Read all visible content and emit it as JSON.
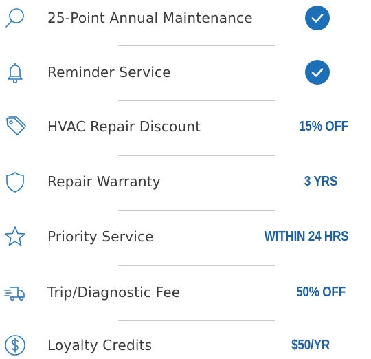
{
  "benefits": [
    {
      "label": "25-Point Annual Maintenance",
      "icon": "search-icon",
      "value": null,
      "included": true
    },
    {
      "label": "Reminder Service",
      "icon": "bell-icon",
      "value": null,
      "included": true
    },
    {
      "label": "HVAC Repair Discount",
      "icon": "tag-icon",
      "value": "15% OFF",
      "included": false
    },
    {
      "label": "Repair Warranty",
      "icon": "shield-icon",
      "value": "3 YRS",
      "included": false
    },
    {
      "label": "Priority Service",
      "icon": "star-icon",
      "value": "WITHIN 24 HRS",
      "included": false
    },
    {
      "label": "Trip/Diagnostic Fee",
      "icon": "delivery-truck-icon",
      "value": "50% OFF",
      "included": false
    },
    {
      "label": "Loyalty Credits",
      "icon": "dollar-coin-icon",
      "value": "$50/YR",
      "included": false
    }
  ],
  "colors": {
    "accent": "#1d5fa3",
    "check_background": "#1d6fb8",
    "icon_stroke": "#2a7ac4",
    "label_text": "#3b3b3b",
    "divider": "#c9c9c9"
  }
}
